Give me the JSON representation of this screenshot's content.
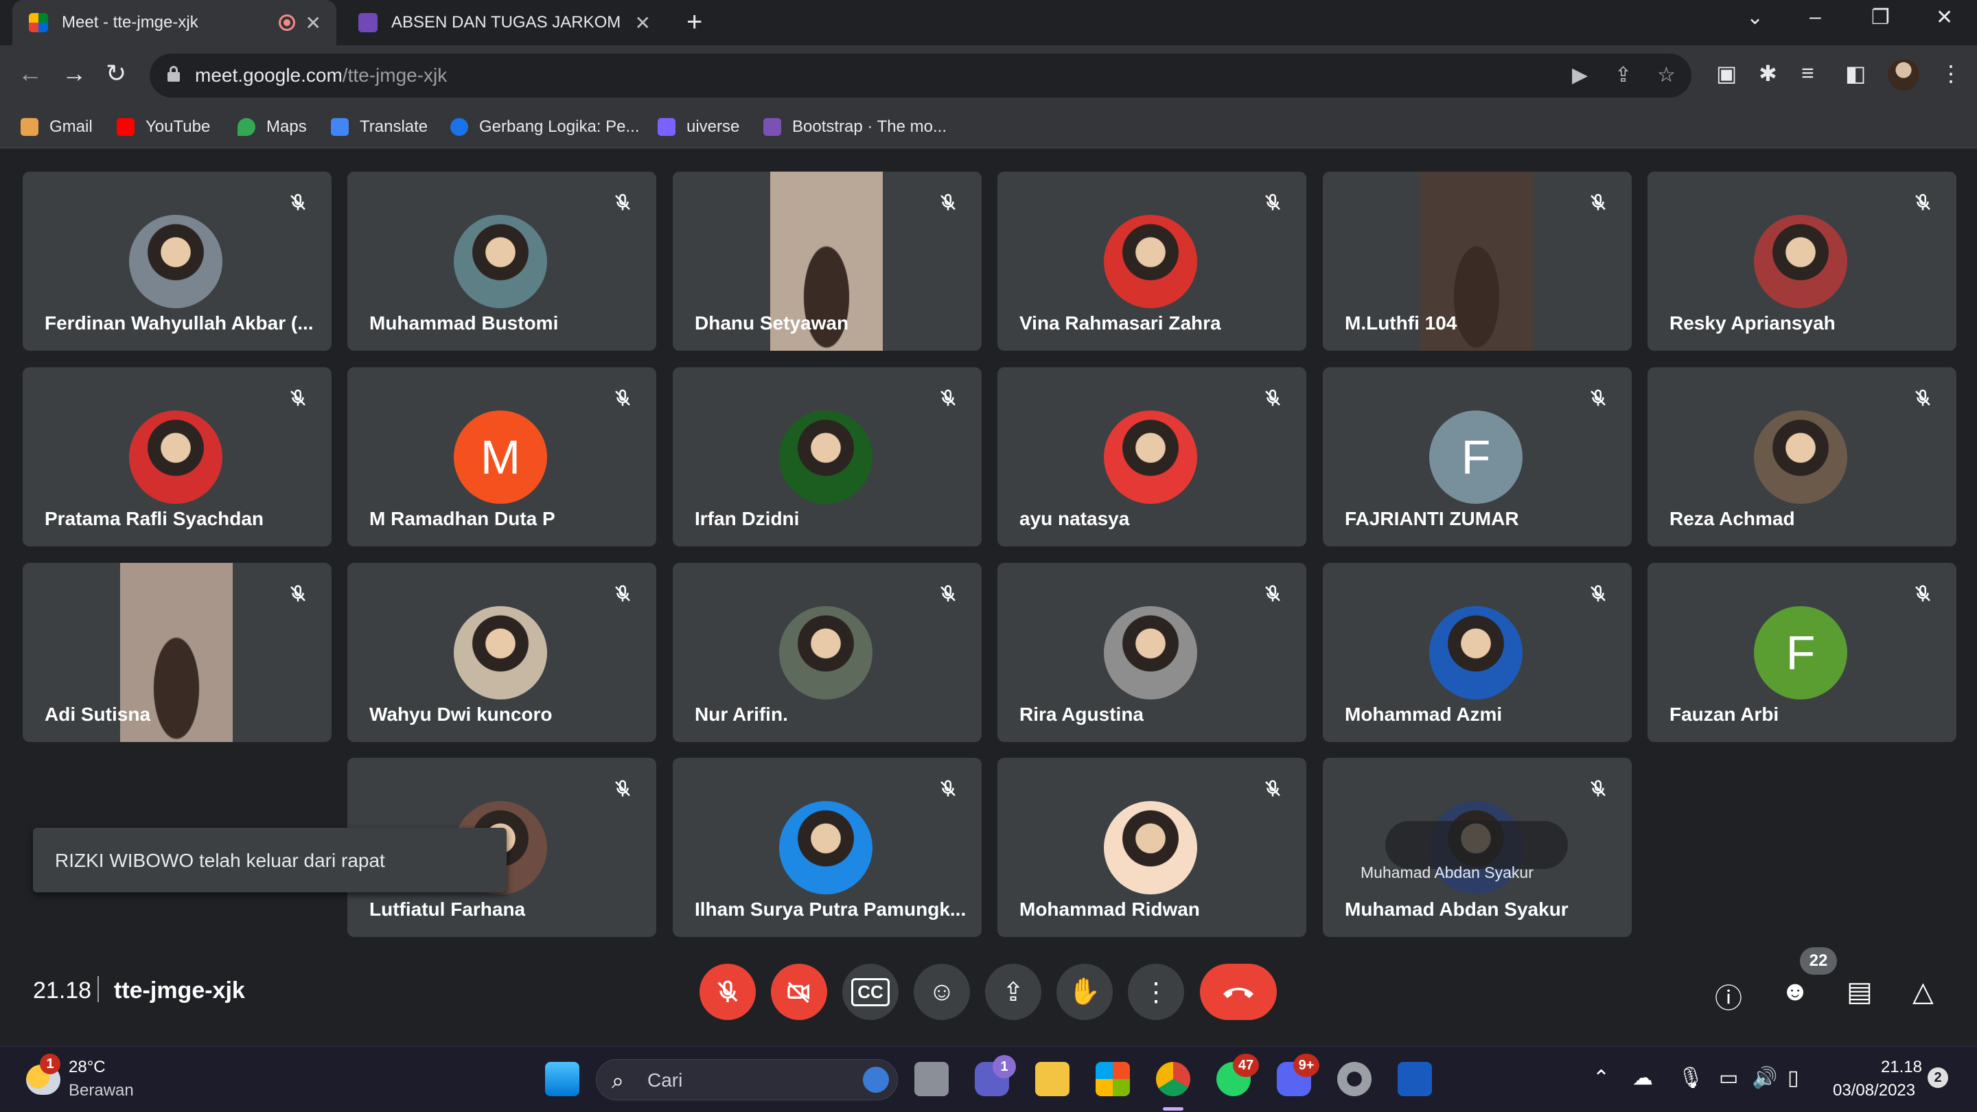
{
  "browser": {
    "tabs": [
      {
        "title": "Meet - tte-jmge-xjk",
        "close": "✕"
      },
      {
        "title": "ABSEN DAN TUGAS JARKOM",
        "close": "✕"
      }
    ],
    "new_tab": "+",
    "url_host": "meet.google.com",
    "url_path": "/tte-jmge-xjk",
    "bookmarks": [
      "Gmail",
      "YouTube",
      "Maps",
      "Translate",
      "Gerbang Logika: Pe...",
      "uiverse",
      "Bootstrap · The mo..."
    ]
  },
  "participants": [
    {
      "name": "Ferdinan Wahyullah Akbar (...",
      "kind": "photo",
      "color": "#7b8590"
    },
    {
      "name": "Muhammad Bustomi",
      "kind": "photo",
      "color": "#5d7f86"
    },
    {
      "name": "Dhanu Setyawan",
      "kind": "video",
      "color": "#b9a898"
    },
    {
      "name": "Vina Rahmasari Zahra",
      "kind": "photo",
      "color": "#d8322c"
    },
    {
      "name": "M.Luthfi 104",
      "kind": "video",
      "color": "#4b3d36"
    },
    {
      "name": "Resky Apriansyah",
      "kind": "photo",
      "color": "#a33a3a"
    },
    {
      "name": "Pratama Rafli Syachdan",
      "kind": "photo",
      "color": "#d32f2f"
    },
    {
      "name": "M Ramadhan Duta P",
      "kind": "initial",
      "initial": "M",
      "color": "#f4511e"
    },
    {
      "name": "Irfan Dzidni",
      "kind": "photo",
      "color": "#1b5e20"
    },
    {
      "name": "ayu natasya",
      "kind": "photo",
      "color": "#e53935"
    },
    {
      "name": "FAJRIANTI ZUMAR",
      "kind": "initial",
      "initial": "F",
      "color": "#78909c"
    },
    {
      "name": "Reza Achmad",
      "kind": "photo",
      "color": "#6b5a4a"
    },
    {
      "name": "Adi Sutisna",
      "kind": "video",
      "color": "#a8968a"
    },
    {
      "name": "Wahyu Dwi kuncoro",
      "kind": "photo",
      "color": "#c7b8a4"
    },
    {
      "name": "Nur Arifin.",
      "kind": "photo",
      "color": "#5e6b5c"
    },
    {
      "name": "Rira Agustina",
      "kind": "photo",
      "color": "#8e8e8e"
    },
    {
      "name": "Mohammad Azmi",
      "kind": "photo",
      "color": "#1e5bb8"
    },
    {
      "name": "Fauzan Arbi",
      "kind": "initial",
      "initial": "F",
      "color": "#5a9e32"
    },
    {
      "name": "Lutfiatul Farhana",
      "kind": "photo",
      "color": "#6d4c41"
    },
    {
      "name": "Ilham Surya Putra Pamungk...",
      "kind": "photo",
      "color": "#1e88e5"
    },
    {
      "name": "Mohammad Ridwan",
      "kind": "photo",
      "color": "#f6dcc4"
    },
    {
      "name": "Muhamad Abdan Syakur",
      "kind": "photo",
      "color": "#2c3e66"
    }
  ],
  "toast": "RIZKI WIBOWO telah keluar dari rapat",
  "hover_name": "Muhamad Abdan Syakur",
  "meeting": {
    "time": "21.18",
    "code": "tte-jmge-xjk",
    "participant_count": "22"
  },
  "taskbar": {
    "weather_temp": "28°C",
    "weather_desc": "Berawan",
    "weather_badge": "1",
    "search_placeholder": "Cari",
    "teams_badge": "1",
    "whatsapp_badge": "47",
    "discord_badge": "9+",
    "clock_time": "21.18",
    "clock_date": "03/08/2023",
    "notif_count": "2"
  }
}
